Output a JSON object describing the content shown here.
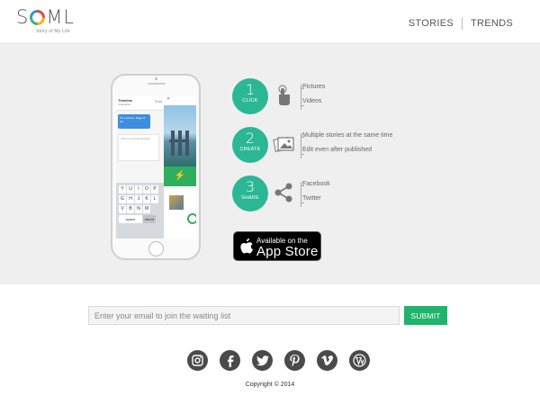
{
  "brand": {
    "name_prefix": "S",
    "name_suffix": "ML",
    "tagline": "Story of My Life"
  },
  "nav": {
    "items": [
      {
        "label": "STORIES"
      },
      {
        "label": "TRENDS"
      }
    ]
  },
  "phone": {
    "nav_title": "Timeline",
    "nav_subtitle": "Unleashed",
    "nav_action": "Post",
    "bubble_text": "It's a picture. Page of Hit.",
    "card_text": "This is not authentication.",
    "keyboard_rows": [
      [
        "Y",
        "U",
        "I",
        "O",
        "P"
      ],
      [
        "G",
        "H",
        "J",
        "K",
        "L"
      ],
      [
        "V",
        "B",
        "N",
        "M"
      ]
    ],
    "space_label": "space",
    "return_label": "return",
    "close_label": "✕"
  },
  "steps": [
    {
      "number": "1",
      "label": "CLICK",
      "icon": "hand-tap-icon",
      "lines": [
        "Pictures",
        "Videos"
      ]
    },
    {
      "number": "2",
      "label": "CREATE",
      "icon": "photos-stack-icon",
      "lines": [
        "Multiple stories at the same time",
        "Edit even after published"
      ]
    },
    {
      "number": "3",
      "label": "SHARE",
      "icon": "share-icon",
      "lines": [
        "Facebook",
        "Twitter"
      ]
    }
  ],
  "appstore": {
    "small": "Available on the",
    "big": "App Store"
  },
  "signup": {
    "placeholder": "Enter your email to join the waiting list",
    "value": "",
    "submit_label": "SUBMIT"
  },
  "social": [
    {
      "icon": "instagram-icon"
    },
    {
      "icon": "facebook-icon"
    },
    {
      "icon": "twitter-icon"
    },
    {
      "icon": "pinterest-icon"
    },
    {
      "icon": "vimeo-icon"
    },
    {
      "icon": "wordpress-icon"
    }
  ],
  "footer": {
    "copyright": "Copyright © 2014"
  },
  "colors": {
    "accent_teal": "#2bb795",
    "submit_green": "#1fb46a",
    "hero_bg": "#efefef",
    "social_gray": "#4a4a4a"
  }
}
